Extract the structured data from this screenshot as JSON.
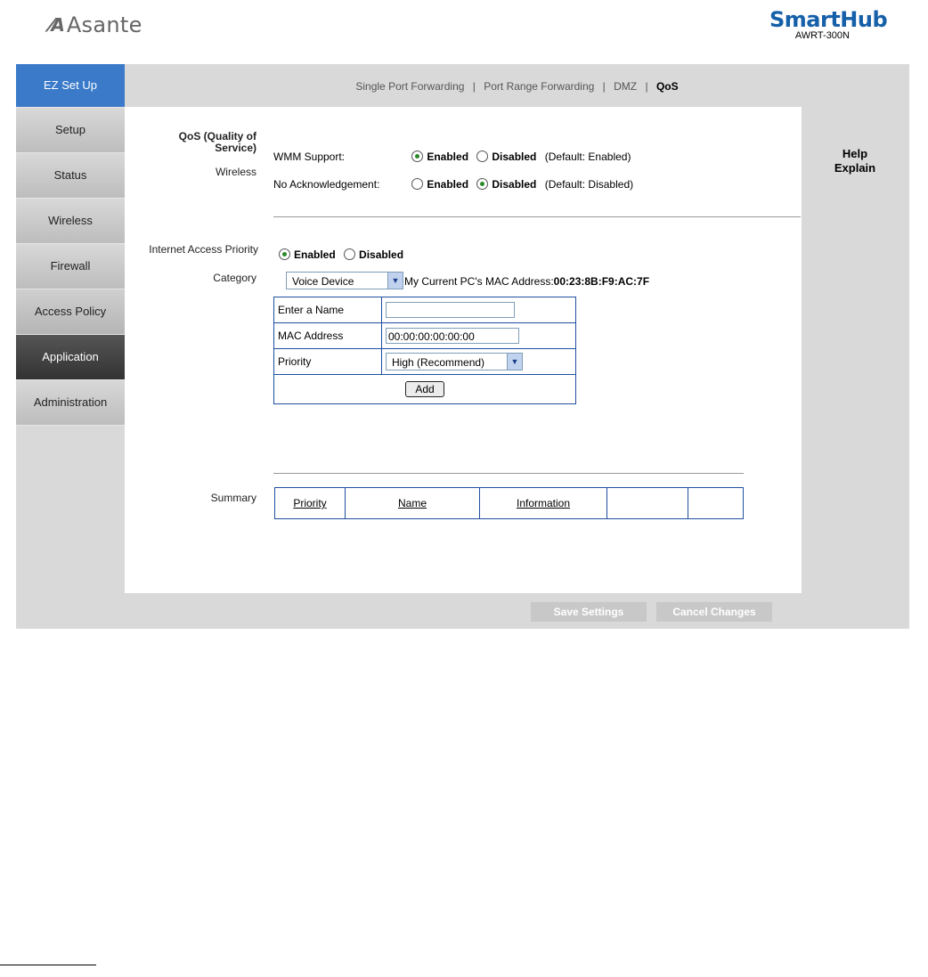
{
  "header": {
    "logo_mark": "⁄A",
    "logo_text": "Asante",
    "brand_name": "SmartHub",
    "brand_model": "AWRT-300N"
  },
  "sidebar": {
    "items": [
      {
        "label": "EZ Set Up"
      },
      {
        "label": "Setup"
      },
      {
        "label": "Status"
      },
      {
        "label": "Wireless"
      },
      {
        "label": "Firewall"
      },
      {
        "label": "Access Policy"
      },
      {
        "label": "Application"
      },
      {
        "label": "Administration"
      }
    ]
  },
  "topnav": {
    "items": [
      "Single Port Forwarding",
      "Port Range Forwarding",
      "DMZ",
      "QoS"
    ],
    "separator": "|"
  },
  "help": {
    "line1": "Help",
    "line2": "Explain"
  },
  "qos": {
    "section_title": "QoS (Quality of Service)",
    "wireless_label": "Wireless",
    "wmm_label": "WMM Support:",
    "wmm_enabled": "Enabled",
    "wmm_disabled": "Disabled",
    "wmm_default": "(Default: Enabled)",
    "noack_label": "No Acknowledgement:",
    "noack_enabled": "Enabled",
    "noack_disabled": "Disabled",
    "noack_default": "(Default: Disabled)",
    "iap_label": "Internet Access Priority",
    "iap_enabled": "Enabled",
    "iap_disabled": "Disabled",
    "category_label": "Category",
    "category_value": "Voice Device",
    "mac_info_label": "My Current PC's MAC Address:",
    "mac_info_value": "00:23:8B:F9:AC:7F",
    "form": {
      "name_label": "Enter a Name",
      "name_value": "",
      "mac_label": "MAC Address",
      "mac_value": "00:00:00:00:00:00",
      "priority_label": "Priority",
      "priority_value": "High (Recommend)",
      "add_label": "Add"
    },
    "summary_label": "Summary",
    "summary_columns": [
      "Priority",
      "Name",
      "Information",
      "",
      ""
    ]
  },
  "footer": {
    "save_label": "Save Settings",
    "cancel_label": "Cancel Changes"
  }
}
